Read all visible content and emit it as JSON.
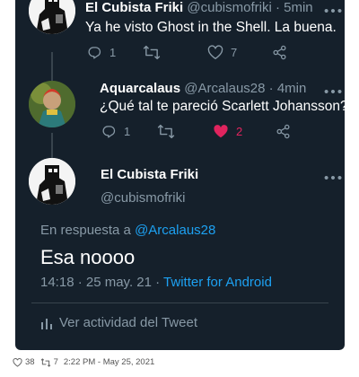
{
  "tweets": [
    {
      "name": "El Cubista Friki",
      "handle": "@cubismofriki",
      "time": "5min",
      "text": "Ya he visto Ghost in the Shell. La buena.",
      "replies": "1",
      "retweets": "",
      "likes": "7",
      "liked": false
    },
    {
      "name": "Aquarcalaus",
      "handle": "@Arcalaus28",
      "time": "4min",
      "text": "¿Qué tal te pareció Scarlett Johansson?",
      "replies": "1",
      "retweets": "",
      "likes": "2",
      "liked": true
    }
  ],
  "main_tweet": {
    "name": "El Cubista Friki",
    "handle": "@cubismofriki",
    "reply_prefix": "En respuesta a",
    "reply_to": "@Arcalaus28",
    "text": "Esa noooo",
    "timestamp": "14:18 · 25 may. 21 ·",
    "source": "Twitter for Android",
    "activity_label": "Ver actividad del Tweet"
  },
  "footer": {
    "likes": "38",
    "retweets": "7",
    "datetime": "2:22 PM - May 25, 2021"
  },
  "colors": {
    "background": "#15202b",
    "text": "#ffffff",
    "secondary": "#8899a6",
    "link": "#1da1f2",
    "like": "#e0245e"
  }
}
